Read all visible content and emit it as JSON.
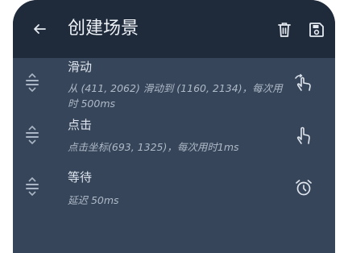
{
  "header": {
    "title": "创建场景"
  },
  "steps": [
    {
      "name": "滑动",
      "desc": "从 (411, 2062) 滑动到 (1160, 2134)，每次用时 500ms",
      "icon": "swipe-gesture-icon"
    },
    {
      "name": "点击",
      "desc": "点击坐标(693, 1325)，每次用时1ms",
      "icon": "tap-gesture-icon"
    },
    {
      "name": "等待",
      "desc": "延迟 50ms",
      "icon": "alarm-clock-icon"
    }
  ],
  "colors": {
    "header_bg": "#1f2a3a",
    "content_bg": "#364559",
    "text_primary": "#dfe5ee",
    "text_secondary": "#aeb9c8"
  }
}
